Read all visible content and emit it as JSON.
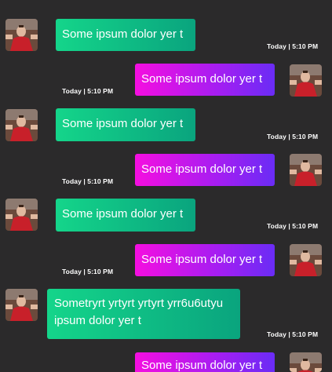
{
  "messages": [
    {
      "direction": "incoming",
      "text": "Some ipsum dolor yer t",
      "time": "Today | 5:10 PM"
    },
    {
      "direction": "outgoing",
      "text": "Some ipsum dolor yer t",
      "time": "Today | 5:10 PM"
    },
    {
      "direction": "incoming",
      "text": "Some ipsum dolor yer t",
      "time": "Today | 5:10 PM"
    },
    {
      "direction": "outgoing",
      "text": "Some ipsum dolor yer t",
      "time": "Today | 5:10 PM"
    },
    {
      "direction": "incoming",
      "text": "Some ipsum dolor yer t",
      "time": "Today | 5:10 PM"
    },
    {
      "direction": "outgoing",
      "text": "Some ipsum dolor yer t",
      "time": "Today | 5:10 PM"
    },
    {
      "direction": "incoming",
      "text": "Sometryrt yrtyrt yrtyrt yrr6u6utyu ipsum dolor yer t",
      "time": "Today | 5:10 PM"
    },
    {
      "direction": "outgoing",
      "text": "Some ipsum dolor yer t",
      "time": ""
    }
  ],
  "colors": {
    "background": "#2b2a2b",
    "incoming_gradient": [
      "#14d58a",
      "#0aa47e"
    ],
    "outgoing_gradient": [
      "#f50ee0",
      "#6a2cf5"
    ]
  },
  "icons": {
    "avatar": "user-avatar-photo-icon"
  }
}
